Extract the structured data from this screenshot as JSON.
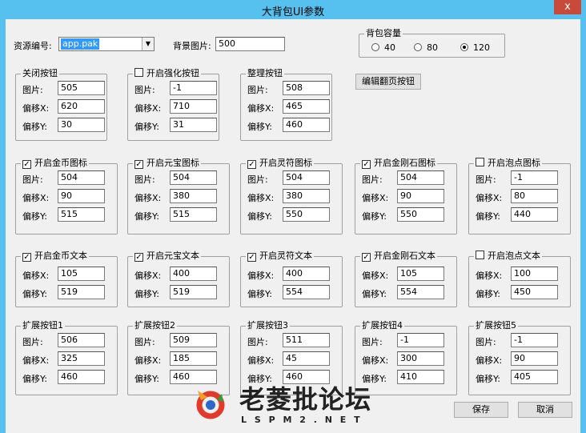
{
  "window": {
    "title": "大背包UI参数",
    "close": "x"
  },
  "top": {
    "resource_label": "资源编号:",
    "resource_value": "app.pak",
    "bg_label": "背景图片:",
    "bg_value": "500",
    "capacity_title": "背包容量",
    "capacity_options": [
      "40",
      "80",
      "120"
    ],
    "capacity_selected": "120",
    "edit_page_button": "编辑翻页按钮"
  },
  "labels": {
    "pic": "图片:",
    "offx": "偏移X:",
    "offy": "偏移Y:"
  },
  "groups_row1": [
    {
      "title": "关闭按钮",
      "checkbox": false,
      "pic": "505",
      "x": "620",
      "y": "30"
    },
    {
      "title": "开启强化按钮",
      "checkbox": true,
      "checked": false,
      "pic": "-1",
      "x": "710",
      "y": "31"
    },
    {
      "title": "整理按钮",
      "checkbox": false,
      "pic": "508",
      "x": "465",
      "y": "460"
    }
  ],
  "groups_row2": [
    {
      "title": "开启金币图标",
      "checked": true,
      "pic": "504",
      "x": "90",
      "y": "515"
    },
    {
      "title": "开启元宝图标",
      "checked": true,
      "pic": "504",
      "x": "380",
      "y": "515"
    },
    {
      "title": "开启灵符图标",
      "checked": true,
      "pic": "504",
      "x": "380",
      "y": "550"
    },
    {
      "title": "开启金刚石图标",
      "checked": true,
      "pic": "504",
      "x": "90",
      "y": "550"
    },
    {
      "title": "开启泡点图标",
      "checked": false,
      "pic": "-1",
      "x": "80",
      "y": "440"
    }
  ],
  "groups_row3": [
    {
      "title": "开启金币文本",
      "checked": true,
      "x": "105",
      "y": "519"
    },
    {
      "title": "开启元宝文本",
      "checked": true,
      "x": "400",
      "y": "519"
    },
    {
      "title": "开启灵符文本",
      "checked": true,
      "x": "400",
      "y": "554"
    },
    {
      "title": "开启金刚石文本",
      "checked": true,
      "x": "105",
      "y": "554"
    },
    {
      "title": "开启泡点文本",
      "checked": false,
      "x": "100",
      "y": "450"
    }
  ],
  "groups_row4": [
    {
      "title": "扩展按钮1",
      "pic": "506",
      "x": "325",
      "y": "460"
    },
    {
      "title": "扩展按钮2",
      "pic": "509",
      "x": "185",
      "y": "460"
    },
    {
      "title": "扩展按钮3",
      "pic": "511",
      "x": "45",
      "y": "460"
    },
    {
      "title": "扩展按钮4",
      "pic": "-1",
      "x": "300",
      "y": "410"
    },
    {
      "title": "扩展按钮5",
      "pic": "-1",
      "x": "90",
      "y": "405"
    }
  ],
  "buttons": {
    "save": "保存",
    "cancel": "取消"
  },
  "watermark": {
    "name": "老菱批论坛",
    "url": "L S P M 2 . N E T"
  }
}
